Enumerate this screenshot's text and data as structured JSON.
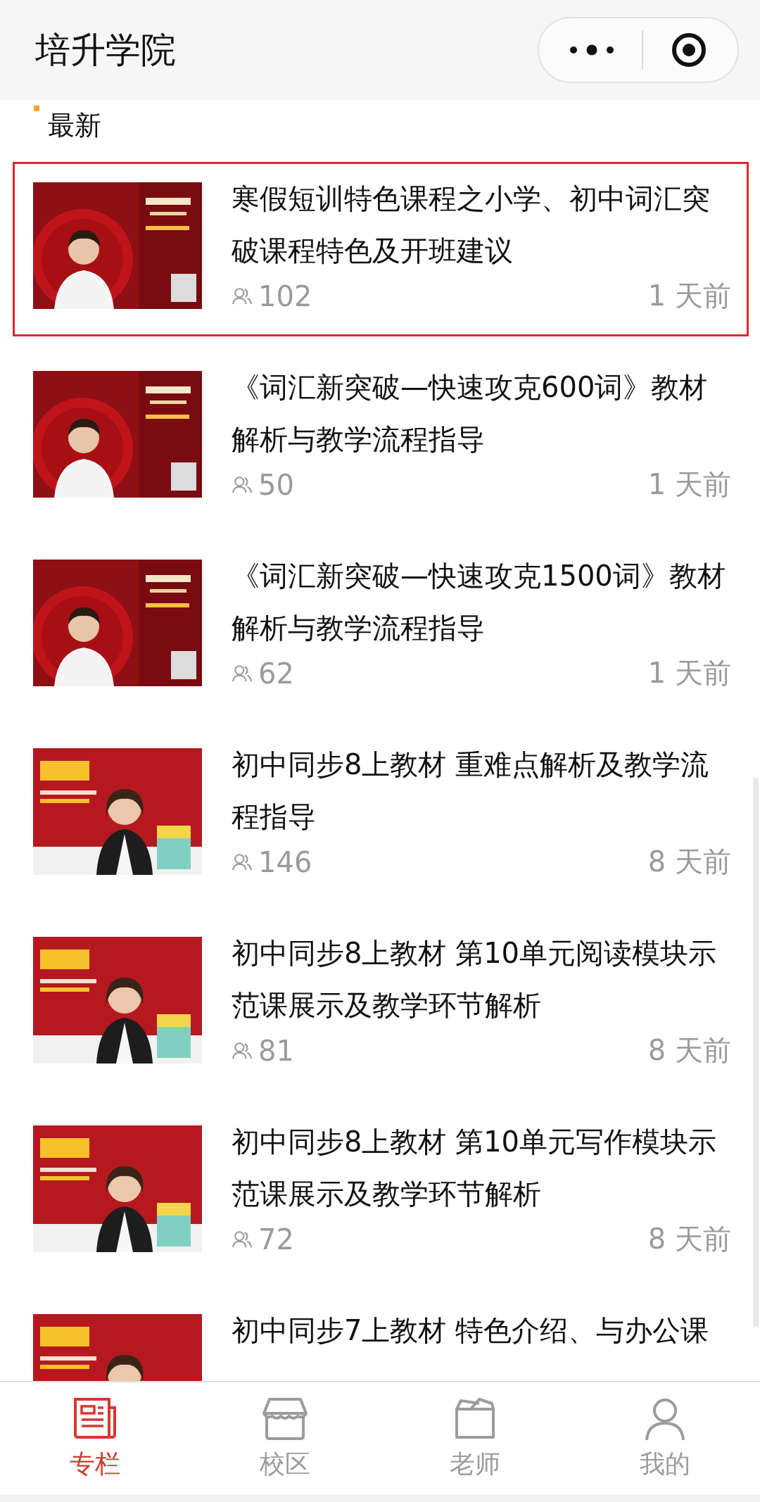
{
  "header": {
    "title": "培升学院"
  },
  "section": {
    "title": "最新"
  },
  "courses": [
    {
      "title": "寒假短训特色课程之小学、初中词汇突破课程特色及开班建议",
      "views": "102",
      "time": "1 天前",
      "selected": true
    },
    {
      "title": "《词汇新突破—快速攻克600词》教材解析与教学流程指导",
      "views": "50",
      "time": "1 天前",
      "selected": false
    },
    {
      "title": "《词汇新突破—快速攻克1500词》教材解析与教学流程指导",
      "views": "62",
      "time": "1 天前",
      "selected": false
    },
    {
      "title": "初中同步8上教材 重难点解析及教学流程指导",
      "views": "146",
      "time": "8 天前",
      "selected": false
    },
    {
      "title": "初中同步8上教材 第10单元阅读模块示范课展示及教学环节解析",
      "views": "81",
      "time": "8 天前",
      "selected": false
    },
    {
      "title": "初中同步8上教材 第10单元写作模块示范课展示及教学环节解析",
      "views": "72",
      "time": "8 天前",
      "selected": false
    },
    {
      "title": "初中同步7上教材 特色介绍、与办公课",
      "selected": false
    }
  ],
  "tabbar": [
    {
      "label": "专栏",
      "kind": "column",
      "selected": true
    },
    {
      "label": "校区",
      "kind": "campus",
      "selected": false
    },
    {
      "label": "老师",
      "kind": "teacher",
      "selected": false
    },
    {
      "label": "我的",
      "kind": "profile",
      "selected": false
    }
  ]
}
